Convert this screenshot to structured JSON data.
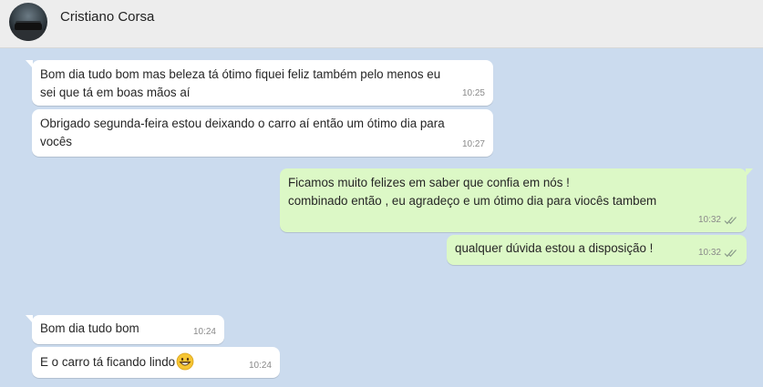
{
  "header": {
    "contact_name": "Cristiano Corsa"
  },
  "messages": [
    {
      "direction": "in",
      "text": "Bom dia tudo bom mas beleza tá ótimo fiquei feliz também pelo menos eu\nsei que tá em boas mãos aí",
      "time": "10:25"
    },
    {
      "direction": "in",
      "text": "Obrigado segunda-feira estou deixando o carro aí então um ótimo dia para\nvocês",
      "time": "10:27"
    },
    {
      "direction": "out",
      "text": "Ficamos muito felizes em saber que confia em nós !\ncombinado então , eu agradeço e um ótimo dia para viocês tambem",
      "time": "10:32"
    },
    {
      "direction": "out",
      "text": "qualquer dúvida estou a disposição !",
      "time": "10:32"
    },
    {
      "direction": "in",
      "text": "Bom dia tudo bom",
      "time": "10:24"
    },
    {
      "direction": "in",
      "text": "E o carro tá ficando lindo",
      "emoji": "grinning-face",
      "time": "10:24"
    }
  ],
  "colors": {
    "chat_background": "#cbdbee",
    "incoming_bubble": "#ffffff",
    "outgoing_bubble": "#dcf8c6",
    "header_background": "#ededed"
  }
}
